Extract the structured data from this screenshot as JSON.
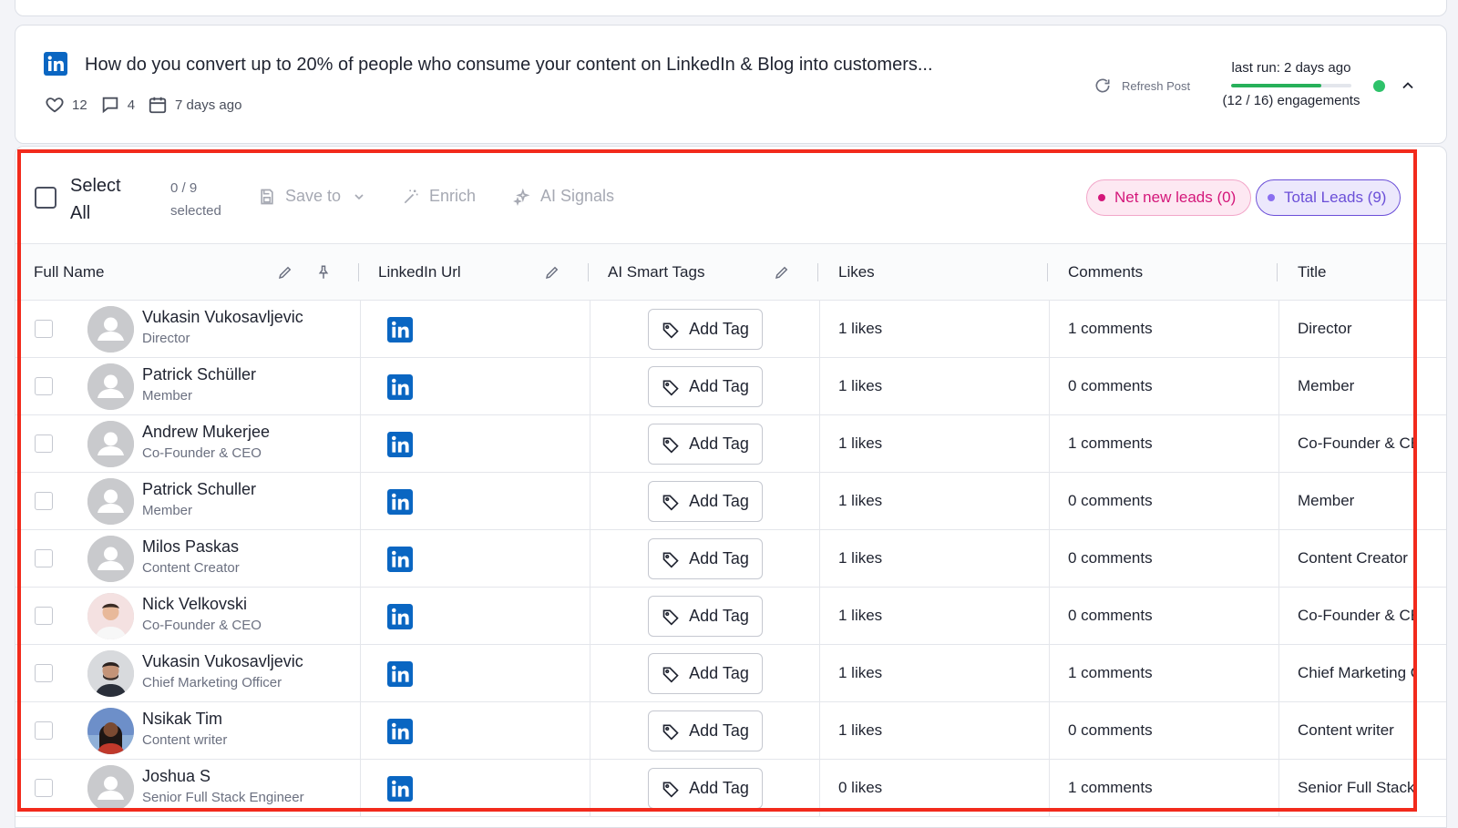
{
  "colors": {
    "accent": "#6b4fd8",
    "pink": "#d4177a",
    "linkedin": "#0a66c2",
    "highlight": "#f22a1c",
    "success": "#2ec26a"
  },
  "post": {
    "title": "How do you convert up to 20% of people who consume your content on LinkedIn & Blog into customers...",
    "likes": "12",
    "comments": "4",
    "date": "7 days ago",
    "refresh_label": "Refresh Post",
    "last_run": "last run: 2 days ago",
    "engagements": "(12 / 16) engagements",
    "progress": 0.75
  },
  "toolbar": {
    "select_all": "Select All",
    "selected_count": "0 / 9 selected",
    "save_to": "Save to",
    "enrich": "Enrich",
    "ai_signals": "AI Signals",
    "net_new": "Net new leads (0)",
    "total": "Total Leads (9)"
  },
  "columns": {
    "full_name": "Full Name",
    "linkedin": "LinkedIn Url",
    "tags": "AI Smart Tags",
    "likes": "Likes",
    "comments": "Comments",
    "title": "Title"
  },
  "add_tag_label": "Add Tag",
  "rows": [
    {
      "name": "Vukasin Vukosavljevic",
      "subtitle": "Director",
      "likes": "1 likes",
      "comments": "1 comments",
      "title": "Director",
      "avatar": "placeholder"
    },
    {
      "name": "Patrick Schüller",
      "subtitle": "Member",
      "likes": "1 likes",
      "comments": "0 comments",
      "title": "Member",
      "avatar": "placeholder"
    },
    {
      "name": "Andrew Mukerjee",
      "subtitle": "Co-Founder & CEO",
      "likes": "1 likes",
      "comments": "1 comments",
      "title": "Co-Founder & CEO",
      "avatar": "placeholder"
    },
    {
      "name": "Patrick Schuller",
      "subtitle": "Member",
      "likes": "1 likes",
      "comments": "0 comments",
      "title": "Member",
      "avatar": "placeholder"
    },
    {
      "name": "Milos Paskas",
      "subtitle": "Content Creator",
      "likes": "1 likes",
      "comments": "0 comments",
      "title": "Content Creator",
      "avatar": "placeholder"
    },
    {
      "name": "Nick Velkovski",
      "subtitle": "Co-Founder & CEO",
      "likes": "1 likes",
      "comments": "0 comments",
      "title": "Co-Founder & CEO",
      "avatar": "photo"
    },
    {
      "name": "Vukasin Vukosavljevic",
      "subtitle": "Chief Marketing Officer",
      "likes": "1 likes",
      "comments": "1 comments",
      "title": "Chief Marketing Officer",
      "avatar": "photo"
    },
    {
      "name": "Nsikak Tim",
      "subtitle": "Content writer",
      "likes": "1 likes",
      "comments": "0 comments",
      "title": "Content writer",
      "avatar": "photo"
    },
    {
      "name": "Joshua S",
      "subtitle": "Senior Full Stack Engineer",
      "likes": "0 likes",
      "comments": "1 comments",
      "title": "Senior Full Stack Engineer",
      "avatar": "placeholder"
    }
  ]
}
